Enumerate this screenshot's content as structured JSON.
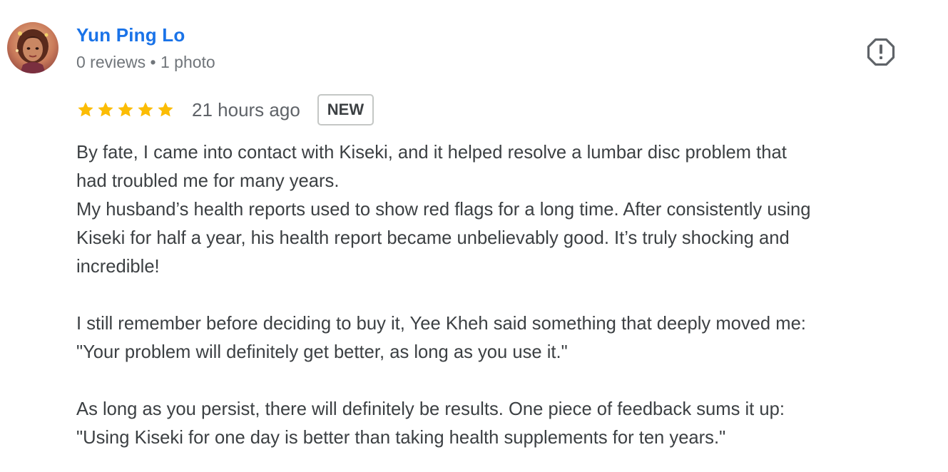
{
  "reviewer": {
    "name": "Yun Ping Lo",
    "meta": "0 reviews • 1 photo"
  },
  "review": {
    "rating": 5,
    "rating_max": 5,
    "time": "21 hours ago",
    "badge": "NEW",
    "lines": [
      "By fate, I came into contact with Kiseki, and it helped resolve a lumbar disc problem that",
      "had troubled me for many years.",
      "My husband’s health reports used to show red flags for a long time. After consistently using",
      "Kiseki for half a year, his health report became unbelievably good. It’s truly shocking and",
      "incredible!",
      "",
      "I still remember before deciding to buy it, Yee Kheh said something that deeply moved me:",
      "\"Your problem will definitely get better, as long as you use it.\"",
      "",
      "As long as you persist, there will definitely be results. One piece of feedback sums it up:",
      "\"Using Kiseki for one day is better than taking health supplements for ten years.\""
    ]
  },
  "icons": {
    "avatar": "avatar-photo",
    "star": "star-icon",
    "report": "report-flag-icon"
  },
  "colors": {
    "name": "#1a73e8",
    "star": "#fbbc04",
    "text": "#3c4043",
    "meta": "#70757a"
  }
}
